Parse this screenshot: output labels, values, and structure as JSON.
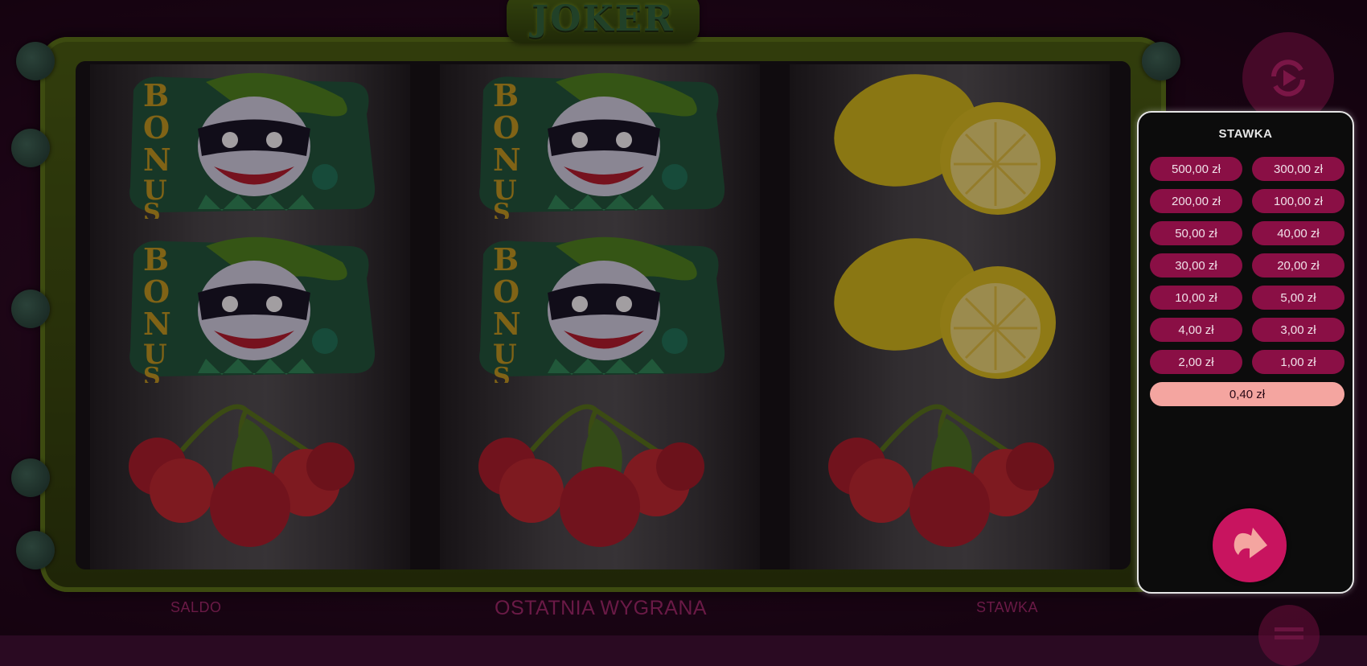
{
  "game": {
    "logo_text": "JOKER",
    "colors": {
      "accent": "#c8145f",
      "bet_option": "#8a0f45",
      "selected_bet": "#f4a5a0",
      "frame": "#4a6310"
    }
  },
  "reels": [
    {
      "symbols": [
        "bonus-joker",
        "bonus-joker",
        "cherries"
      ]
    },
    {
      "symbols": [
        "bonus-joker",
        "bonus-joker",
        "cherries"
      ]
    },
    {
      "symbols": [
        "lemons",
        "lemons",
        "cherries"
      ]
    }
  ],
  "bonus_text": "BONUS",
  "bottom_bar": {
    "saldo_label": "SALDO",
    "last_win_label": "OSTATNIA WYGRANA",
    "stake_label": "STAWKA"
  },
  "bet_panel": {
    "title": "STAWKA",
    "options": [
      "500,00 zł",
      "300,00 zł",
      "200,00 zł",
      "100,00 zł",
      "50,00 zł",
      "40,00 zł",
      "30,00 zł",
      "20,00 zł",
      "10,00 zł",
      "5,00 zł",
      "4,00 zł",
      "3,00 zł",
      "2,00 zł",
      "1,00 zł"
    ],
    "selected": "0,40 zł",
    "confirm_icon": "arrow-right-icon"
  },
  "side_icons": [
    "autoplay-icon",
    "coins-icon",
    "menu-icon"
  ]
}
